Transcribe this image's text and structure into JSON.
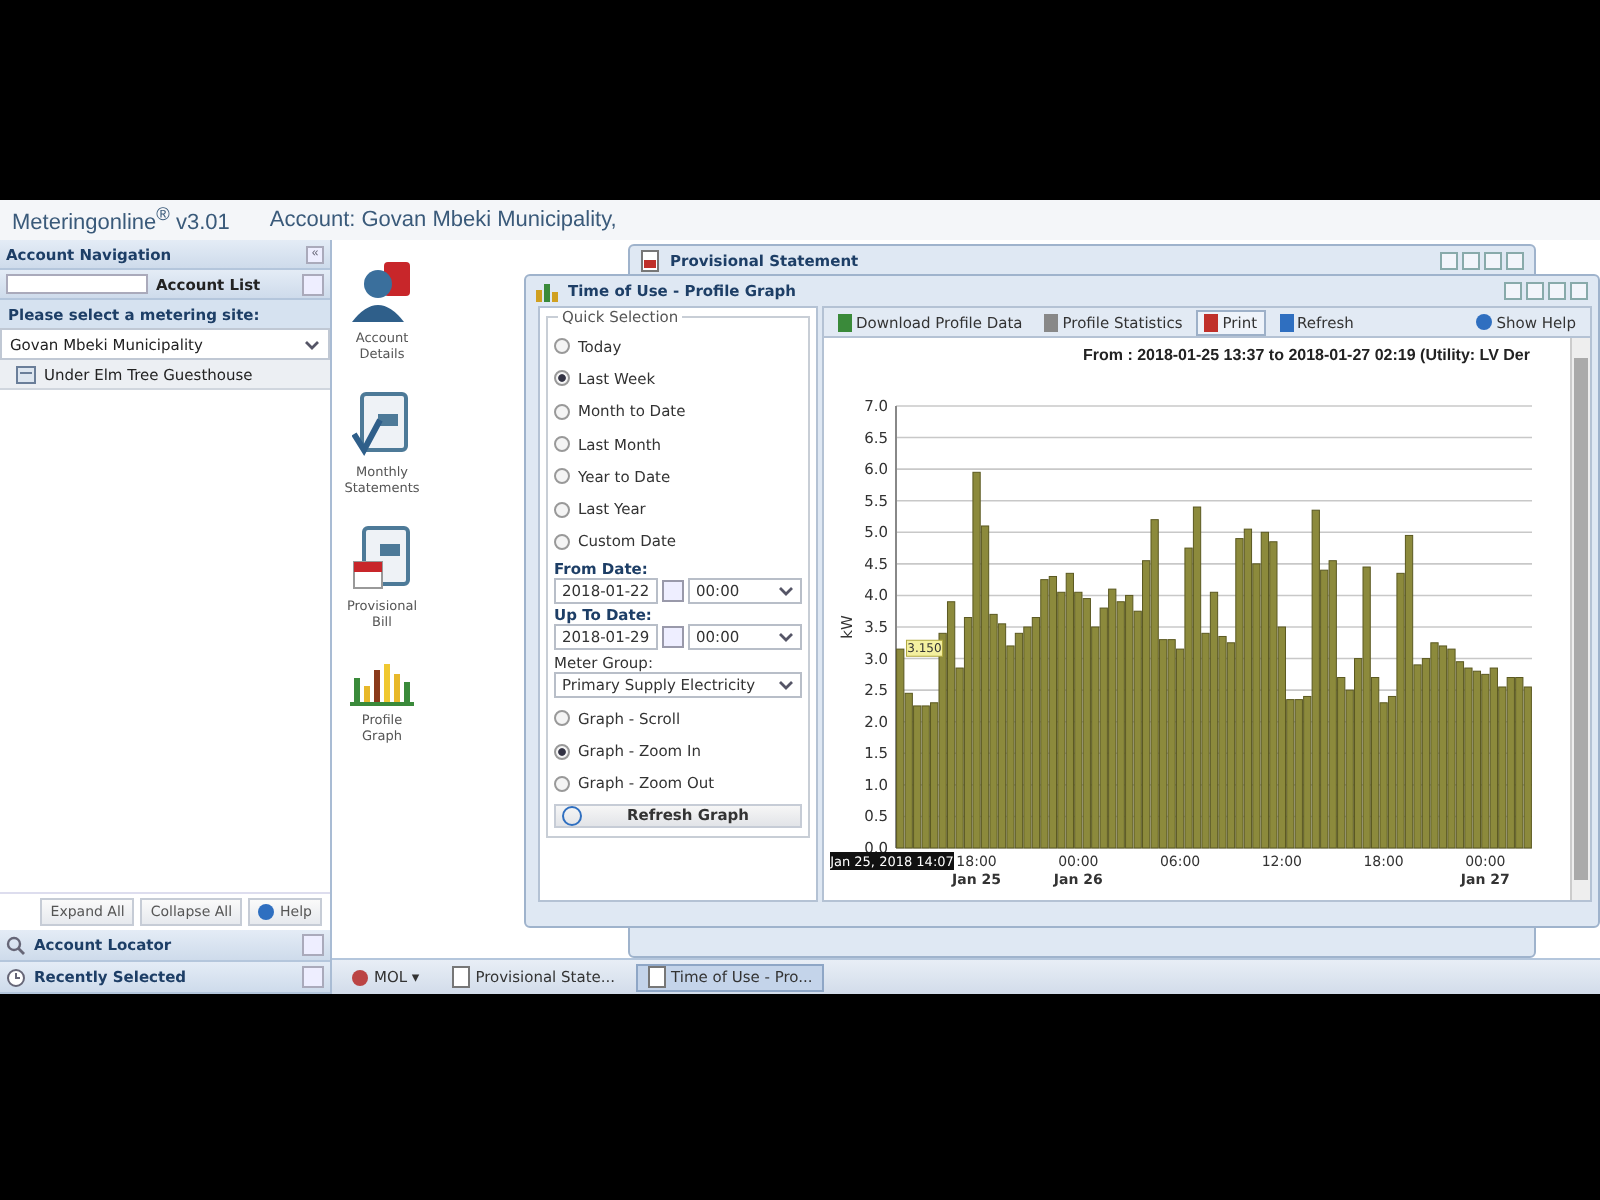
{
  "app_header": {
    "title": "Meteringonline$^{®}$ v3.01",
    "account": "Account: Govan Mbeki Municipality,"
  },
  "navigation": {
    "title": "Account Navigation",
    "collapse": "«",
    "account_list": "Account List",
    "prompt": "Please select a metering site:",
    "site": "Govan Mbeki Municipality",
    "tree": [
      {
        "label": "Under Elm Tree Guesthouse"
      }
    ],
    "buttons": [
      "Expand All",
      "Collapse All",
      "Help"
    ],
    "sections": [
      {
        "label": "Account Locator",
        "kind": "search"
      },
      {
        "label": "Recently Selected",
        "kind": "recent"
      }
    ]
  },
  "shortcuts": [
    {
      "label": "Account Details",
      "kind": "account"
    },
    {
      "label": "Monthly Statements",
      "kind": "statement"
    },
    {
      "label": "Provisional Bill",
      "kind": "bill"
    },
    {
      "label": "Profile Graph",
      "kind": "graph"
    }
  ],
  "back_window": {
    "title": "Provisional Statement"
  },
  "window": {
    "title": "Time of Use - Profile Graph",
    "quick_selection": {
      "legend": "Quick Selection",
      "options": [
        {
          "label": "Today",
          "selected": false
        },
        {
          "label": "Last Week",
          "selected": true
        },
        {
          "label": "Month to Date",
          "selected": false
        },
        {
          "label": "Last Month",
          "selected": false
        },
        {
          "label": "Year to Date",
          "selected": false
        },
        {
          "label": "Last Year",
          "selected": false
        },
        {
          "label": "Custom Date",
          "selected": false
        }
      ],
      "from_label": "From Date:",
      "from_date": "2018-01-22",
      "from_time": "00:00",
      "to_label": "Up To Date:",
      "to_date": "2018-01-29",
      "to_time": "00:00",
      "meter_label": "Meter Group:",
      "meter_group": "Primary Supply Electricity",
      "graph_modes": [
        {
          "label": "Graph - Scroll",
          "selected": false
        },
        {
          "label": "Graph - Zoom In",
          "selected": true
        },
        {
          "label": "Graph - Zoom Out",
          "selected": false
        }
      ],
      "refresh": "Refresh Graph"
    },
    "toolbar": [
      {
        "label": "Download Profile Data",
        "kind": "download"
      },
      {
        "label": "Profile Statistics",
        "kind": "stats"
      },
      {
        "label": "Print",
        "kind": "print"
      },
      {
        "label": "Refresh",
        "kind": "refresh"
      }
    ],
    "help": "Show Help",
    "chart_title": "From : 2018-01-25 13:37 to 2018-01-27 02:19   (Utility: LV Der",
    "chart_data": {
      "type": "bar",
      "ylabel": "kW",
      "ylim": [
        0,
        7
      ],
      "grid": true,
      "yticks": [
        {
          "value": 0,
          "label": "0.0"
        },
        {
          "value": 0.5,
          "label": "0.5"
        },
        {
          "value": 1,
          "label": "1.0"
        },
        {
          "value": 1.5,
          "label": "1.5"
        },
        {
          "value": 2,
          "label": "2.0"
        },
        {
          "value": 2.5,
          "label": "2.5"
        },
        {
          "value": 3,
          "label": "3.0"
        },
        {
          "value": 3.5,
          "label": "3.5"
        },
        {
          "value": 4,
          "label": "4.0"
        },
        {
          "value": 4.5,
          "label": "4.5"
        },
        {
          "value": 5,
          "label": "5.0"
        },
        {
          "value": 5.5,
          "label": "5.5"
        },
        {
          "value": 6,
          "label": "6.0"
        },
        {
          "value": 6.5,
          "label": "6.5"
        },
        {
          "value": 7,
          "label": "7.0"
        }
      ],
      "categories": [
        null,
        null,
        null,
        null,
        null,
        null,
        null,
        null,
        null,
        "18:00\nJan 25",
        null,
        null,
        null,
        null,
        null,
        null,
        null,
        null,
        null,
        null,
        null,
        "00:00\nJan 26",
        null,
        null,
        null,
        null,
        null,
        null,
        null,
        null,
        null,
        null,
        null,
        "06:00",
        null,
        null,
        null,
        null,
        null,
        null,
        null,
        null,
        null,
        null,
        null,
        "12:00",
        null,
        null,
        null,
        null,
        null,
        null,
        null,
        null,
        null,
        null,
        null,
        "18:00",
        null,
        null,
        null,
        null,
        null,
        null,
        null,
        null,
        null,
        null,
        null,
        "00:00\nJan 27",
        null,
        null,
        null,
        null,
        null
      ],
      "series": [
        {
          "color": "#8c8a3c",
          "values": [
            3.15,
            2.45,
            2.25,
            2.25,
            2.3,
            3.4,
            3.9,
            2.85,
            3.65,
            5.95,
            5.1,
            3.7,
            3.55,
            3.2,
            3.4,
            3.5,
            3.65,
            4.25,
            4.3,
            4.05,
            4.35,
            4.05,
            3.95,
            3.5,
            3.8,
            4.1,
            3.9,
            4.0,
            3.75,
            4.55,
            5.2,
            3.3,
            3.3,
            3.15,
            4.75,
            5.4,
            3.4,
            4.05,
            3.35,
            3.25,
            4.9,
            5.05,
            4.5,
            5.0,
            4.85,
            3.5,
            2.35,
            2.35,
            2.4,
            5.35,
            4.4,
            4.55,
            2.7,
            2.5,
            3.0,
            4.45,
            2.7,
            2.3,
            2.4,
            4.35,
            4.95,
            2.9,
            3.0,
            3.25,
            3.2,
            3.15,
            2.95,
            2.85,
            2.8,
            2.75,
            2.85,
            2.55,
            2.7,
            2.7,
            2.55
          ]
        }
      ],
      "annotations": [
        "3.150",
        "Jan 25, 2018 14:07"
      ]
    }
  },
  "taskbar": [
    {
      "label": "MOL ▾",
      "kind": "start",
      "selected": false
    },
    {
      "label": "Provisional State...",
      "kind": "window",
      "selected": false
    },
    {
      "label": "Time of Use - Pro...",
      "kind": "window",
      "selected": true
    }
  ]
}
